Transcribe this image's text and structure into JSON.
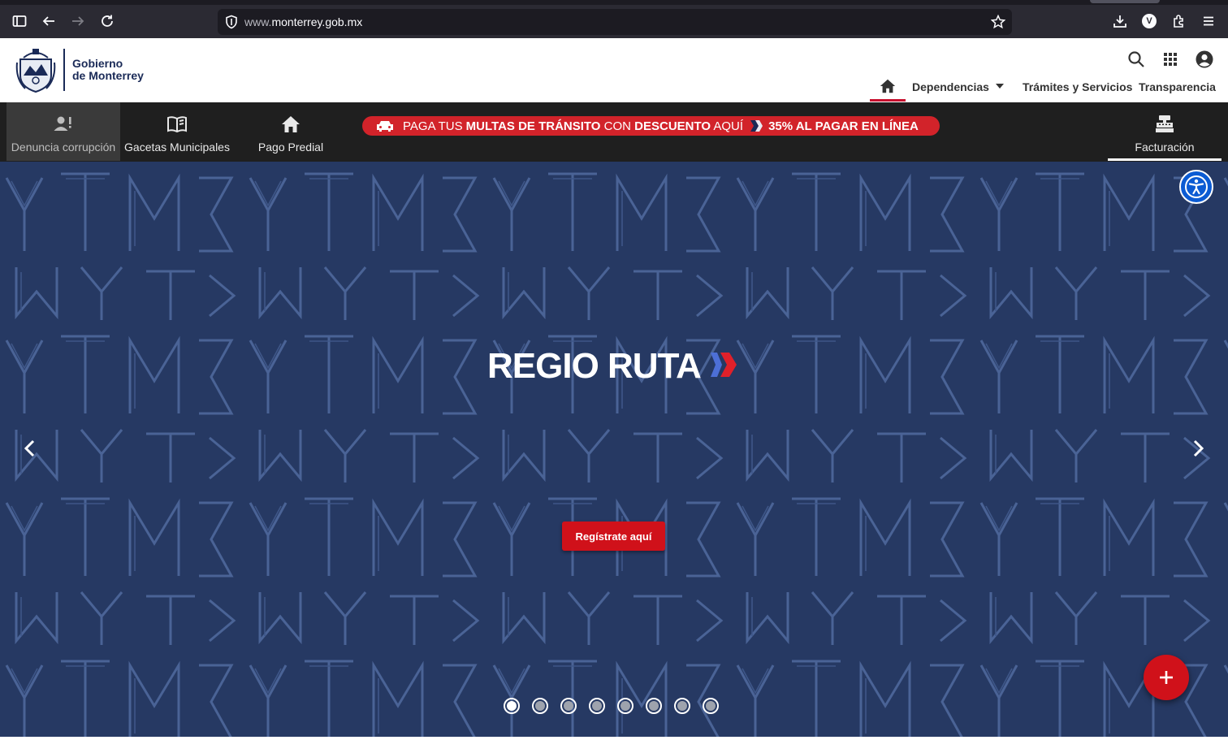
{
  "browser": {
    "url_domain": "monterrey.gob.mx",
    "url_prefix": "www.",
    "profile_initial": "V"
  },
  "header": {
    "logo_line1": "Gobierno",
    "logo_line2": "de Monterrey",
    "nav": {
      "dependencias": "Dependencias",
      "tramites": "Trámites y Servicios",
      "transparencia": "Transparencia"
    }
  },
  "toolbar": {
    "items": [
      {
        "label": "Denuncia corrupción",
        "icon": "person-alert-icon"
      },
      {
        "label": "Gacetas Municipales",
        "icon": "book-icon"
      },
      {
        "label": "Pago Predial",
        "icon": "home-icon"
      }
    ],
    "facturacion": "Facturación",
    "promo": {
      "part1": "PAGA TUS ",
      "part2": "MULTAS DE TRÁNSITO",
      "part3": " CON ",
      "part4": "DESCUENTO",
      "part5": " AQUÍ",
      "part6": "35% AL PAGAR EN LÍNEA"
    }
  },
  "hero": {
    "title": "REGIO RUTA",
    "pattern_letters": "YTM",
    "cta": "Regístrate aquí",
    "slide_count": 8,
    "active_slide": 1
  },
  "colors": {
    "accent_red": "#d0111a",
    "navy": "#1a2a57",
    "hero_bg": "#263963",
    "accessibility_blue": "#0b5bd3"
  }
}
